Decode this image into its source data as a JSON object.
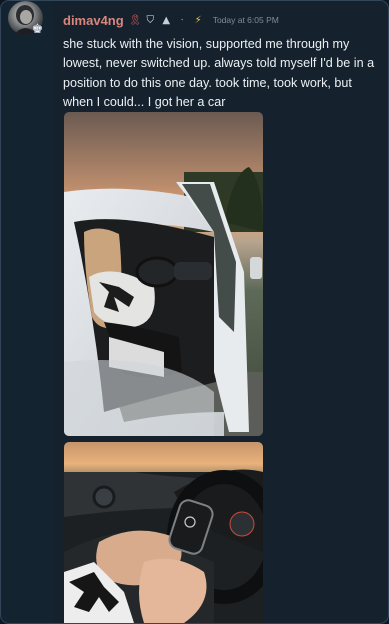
{
  "message": {
    "author": {
      "username": "dimav4ng",
      "username_color": "#d9867c",
      "badges": [
        "ribbon-badge-icon",
        "shield-badge-icon",
        "graduation-cap-badge-icon",
        "pin-badge-icon",
        "lightning-badge-icon"
      ],
      "role_icon": "crown-icon"
    },
    "timestamp": "Today at 6:05 PM",
    "text": "she stuck with the vision, supported me through my lowest, never switched up. always told myself I'd be in a position to do this one day. took time, took work, but when I could... I got her a car",
    "attachments": [
      {
        "kind": "photo",
        "subject": "woman-in-white-car-at-sunset"
      },
      {
        "kind": "photo",
        "subject": "hand-holding-car-key-fob"
      }
    ]
  },
  "colors": {
    "background": "#15222e",
    "text": "#ecf0f3",
    "timestamp": "#7e8d9c"
  }
}
